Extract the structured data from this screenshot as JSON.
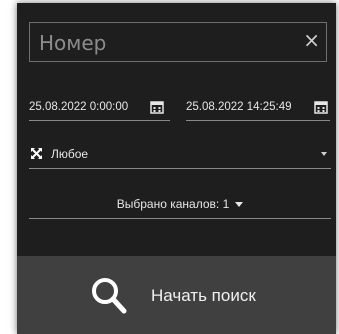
{
  "search_form": {
    "number_placeholder": "Номер",
    "clear_glyph": "×",
    "date_from": "25.08.2022 0:00:00",
    "date_to": "25.08.2022 14:25:49",
    "type_label": "Любое",
    "channels_label": "Выбрано каналов: 1",
    "search_button_label": "Начать поиск"
  },
  "icons": {
    "calendar": "calendar-icon",
    "type": "expand-arrows-icon",
    "search": "magnifier-icon"
  },
  "colors": {
    "panel_bg": "#1e1e1e",
    "button_bg": "#404040",
    "text": "#e6e6e6",
    "placeholder": "#8c8c8c"
  }
}
